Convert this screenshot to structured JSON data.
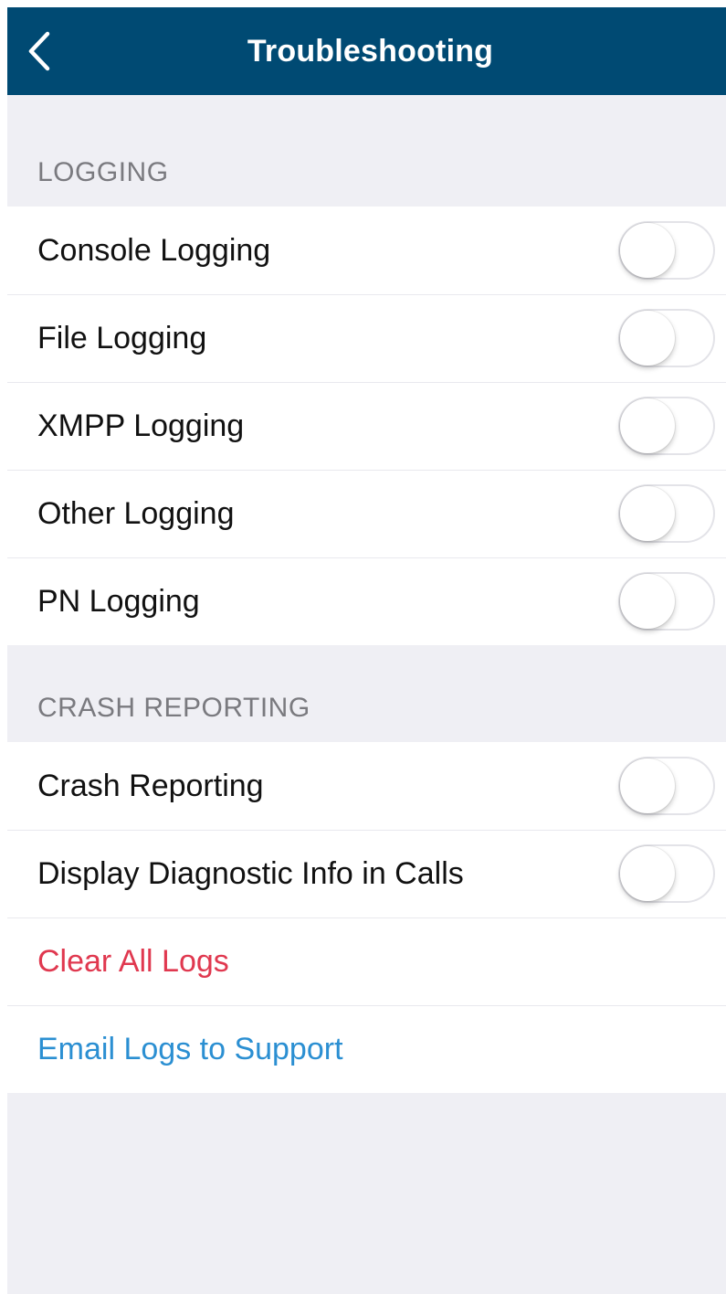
{
  "nav": {
    "title": "Troubleshooting",
    "back_icon": "chevron-left-icon"
  },
  "colors": {
    "nav_background": "#004a73",
    "screen_background": "#efeff4",
    "danger": "#e0384f",
    "link": "#2b8fd2"
  },
  "logging": {
    "header": "LOGGING",
    "items": [
      {
        "label": "Console Logging",
        "enabled": false
      },
      {
        "label": "File Logging",
        "enabled": false
      },
      {
        "label": "XMPP Logging",
        "enabled": false
      },
      {
        "label": "Other Logging",
        "enabled": false
      },
      {
        "label": "PN Logging",
        "enabled": false
      }
    ]
  },
  "crash": {
    "header": "CRASH REPORTING",
    "items": [
      {
        "label": "Crash Reporting",
        "enabled": false
      },
      {
        "label": "Display Diagnostic Info in Calls",
        "enabled": false
      }
    ],
    "clear_logs_label": "Clear All Logs",
    "email_logs_label": "Email Logs to Support"
  }
}
